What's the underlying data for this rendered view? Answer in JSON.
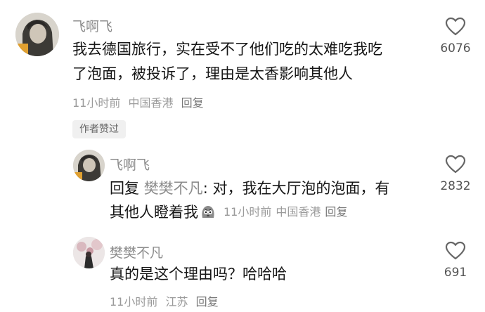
{
  "main_comment": {
    "author": "飞啊飞",
    "text_line1": "我去德国旅行，实在受不了他们吃的太难吃我吃",
    "text_line2": "了泡面，被投诉了，理由是太香影响其他人",
    "time": "11小时前",
    "location": "中国香港",
    "reply_label": "回复",
    "likes": "6076",
    "author_liked_badge": "作者赞过"
  },
  "reply1": {
    "author": "飞啊飞",
    "reply_prefix": "回复",
    "reply_to": "樊樊不凡",
    "text_line1": ": 对，我在大厅泡的泡面，有",
    "text_line2": "其他人瞪着我",
    "time": "11小时前",
    "location": "中国香港",
    "reply_label": "回复",
    "likes": "2832"
  },
  "reply2": {
    "author": "樊樊不凡",
    "text_line1": "真的是这个理由吗？哈哈哈",
    "time": "11小时前",
    "location": "江苏",
    "reply_label": "回复",
    "likes": "691"
  },
  "icons": {
    "like": "heart-outline-icon",
    "emoji": "staring-emoji-icon"
  }
}
